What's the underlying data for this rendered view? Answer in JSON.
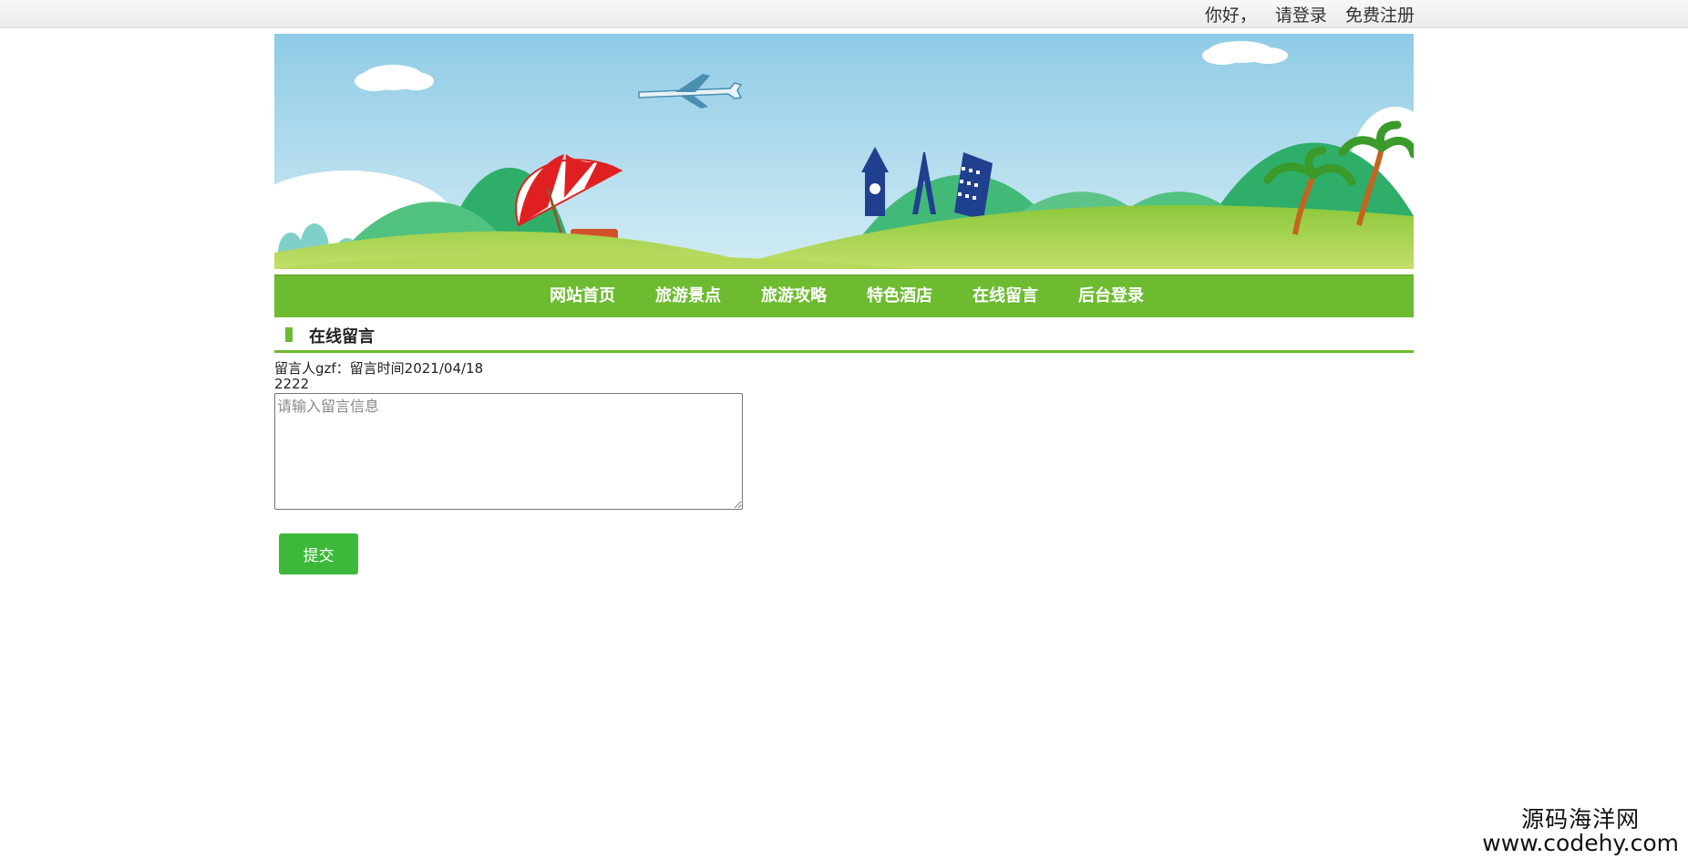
{
  "topbar": {
    "greeting": "你好，",
    "login_link": "请登录",
    "register_link": "免费注册"
  },
  "banner": {
    "sky_color": "#a6d8ec",
    "hill_colors": [
      "#2fae6a",
      "#51c27f",
      "#8cc83b",
      "#b6d85a"
    ]
  },
  "nav": {
    "background": "#6dbb30",
    "items": [
      {
        "label": "网站首页"
      },
      {
        "label": "旅游景点"
      },
      {
        "label": "旅游攻略"
      },
      {
        "label": "特色酒店"
      },
      {
        "label": "在线留言"
      },
      {
        "label": "后台登录"
      }
    ]
  },
  "section": {
    "title": "在线留言"
  },
  "message": {
    "meta": "留言人gzf：留言时间2021/04/18",
    "content": "2222"
  },
  "form": {
    "placeholder": "请输入留言信息",
    "value": "",
    "submit_label": "提交"
  },
  "watermark": {
    "name": "源码海洋网",
    "url": "www.codehy.com"
  }
}
